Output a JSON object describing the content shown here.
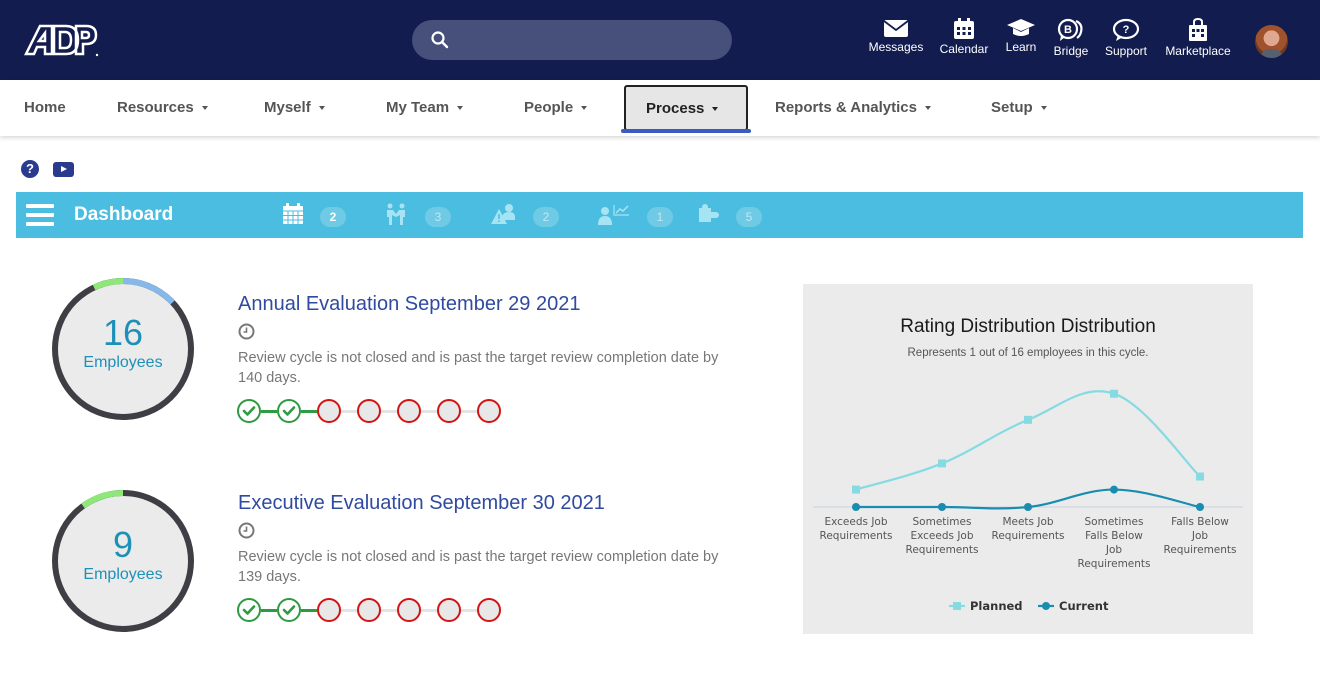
{
  "header": {
    "logo": "ADP",
    "search": {
      "placeholder": "",
      "value": ""
    },
    "icons": [
      {
        "name": "messages",
        "label": "Messages",
        "icon": "envelope-icon"
      },
      {
        "name": "calendar",
        "label": "Calendar",
        "icon": "calendar-icon"
      },
      {
        "name": "learn",
        "label": "Learn",
        "icon": "graduation-cap-icon"
      },
      {
        "name": "bridge",
        "label": "Bridge",
        "icon": "bridge-chat-icon"
      },
      {
        "name": "support",
        "label": "Support",
        "icon": "question-bubble-icon"
      },
      {
        "name": "marketplace",
        "label": "Marketplace",
        "icon": "shopping-bag-icon"
      }
    ],
    "avatar": "user-avatar"
  },
  "nav": {
    "items": [
      {
        "label": "Home",
        "dropdown": false
      },
      {
        "label": "Resources",
        "dropdown": true
      },
      {
        "label": "Myself",
        "dropdown": true
      },
      {
        "label": "My Team",
        "dropdown": true
      },
      {
        "label": "People",
        "dropdown": true
      },
      {
        "label": "Process",
        "dropdown": true,
        "active": true
      },
      {
        "label": "Reports & Analytics",
        "dropdown": true
      },
      {
        "label": "Setup",
        "dropdown": true
      }
    ]
  },
  "help": {
    "help_icon": "?",
    "video_icon": "youtube-icon"
  },
  "dashboard": {
    "title": "Dashboard",
    "stats": [
      {
        "icon": "calendar-icon",
        "count": "2"
      },
      {
        "icon": "handshake-people-icon",
        "count": "3"
      },
      {
        "icon": "warning-person-icon",
        "count": "2"
      },
      {
        "icon": "person-chart-icon",
        "count": "1"
      },
      {
        "icon": "puzzle-icon",
        "count": "5"
      }
    ]
  },
  "reviews": [
    {
      "count": "16",
      "count_label": "Employees",
      "ring_segments": {
        "green_fraction": 0.07,
        "blue_fraction": 0.13
      },
      "title": "Annual Evaluation September 29 2021",
      "description": "Review cycle is not closed and is past the target review completion date by 140 days.",
      "steps_completed": 2,
      "steps_total": 7
    },
    {
      "count": "9",
      "count_label": "Employees",
      "ring_segments": {
        "green_fraction": 0.1,
        "blue_fraction": 0
      },
      "title": "Executive Evaluation September 30 2021",
      "description": "Review cycle is not closed and is past the target review completion date by 139 days.",
      "steps_completed": 2,
      "steps_total": 7
    }
  ],
  "chart_data": {
    "type": "line",
    "title": "Rating Distribution Distribution",
    "subtitle": "Represents 1 out of 16 employees in this cycle.",
    "categories": [
      "Exceeds Job Requirements",
      "Sometimes Exceeds Job Requirements",
      "Meets Job Requirements",
      "Sometimes Falls Below Job Requirements",
      "Falls Below Job Requirements"
    ],
    "category_lines": [
      [
        "Exceeds Job",
        "Requirements"
      ],
      [
        "Sometimes",
        "Exceeds Job",
        "Requirements"
      ],
      [
        "Meets Job",
        "Requirements"
      ],
      [
        "Sometimes",
        "Falls Below",
        "Job",
        "Requirements"
      ],
      [
        "Falls Below",
        "Job",
        "Requirements"
      ]
    ],
    "series": [
      {
        "name": "Planned",
        "values": [
          1,
          2.5,
          5,
          6.5,
          1.75
        ],
        "color": "#86dbe2",
        "marker": "square"
      },
      {
        "name": "Current",
        "values": [
          0,
          0,
          0,
          1,
          0
        ],
        "color": "#1a8cb0",
        "marker": "circle"
      }
    ],
    "ylim": [
      0,
      7
    ],
    "legend": "bottom-center",
    "grid": false
  }
}
